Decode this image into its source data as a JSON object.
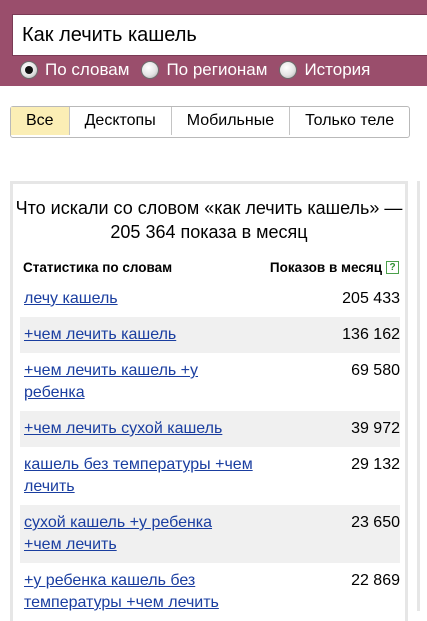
{
  "search": {
    "query": "Как лечить кашель"
  },
  "modes": [
    {
      "label": "По словам",
      "checked": true
    },
    {
      "label": "По регионам",
      "checked": false
    },
    {
      "label": "История",
      "checked": false
    }
  ],
  "tabs": [
    "Все",
    "Десктопы",
    "Мобильные",
    "Только теле"
  ],
  "panel": {
    "title": "Что искали со словом «как лечить кашель» — 205 364 показа в месяц",
    "col_phrase": "Статистика по словам",
    "col_count": "Показов в месяц",
    "help_icon": "?",
    "rows": [
      {
        "phrase": "лечу кашель",
        "count": "205 433"
      },
      {
        "phrase": "+чем лечить кашель",
        "count": "136 162"
      },
      {
        "phrase": "+чем лечить кашель +у ребенка",
        "count": "69 580"
      },
      {
        "phrase": "+чем лечить сухой кашель",
        "count": "39 972"
      },
      {
        "phrase": "кашель без температуры +чем лечить",
        "count": "29 132"
      },
      {
        "phrase": "сухой кашель +у ребенка +чем лечить",
        "count": "23 650"
      },
      {
        "phrase": "+у ребенка кашель без температуры +чем лечить",
        "count": "22 869"
      }
    ]
  },
  "colors": {
    "band": "#9a4e6c",
    "link": "#1a3ea0",
    "active_tab": "#fbeeb5",
    "alt_row": "#f0f0f0"
  }
}
